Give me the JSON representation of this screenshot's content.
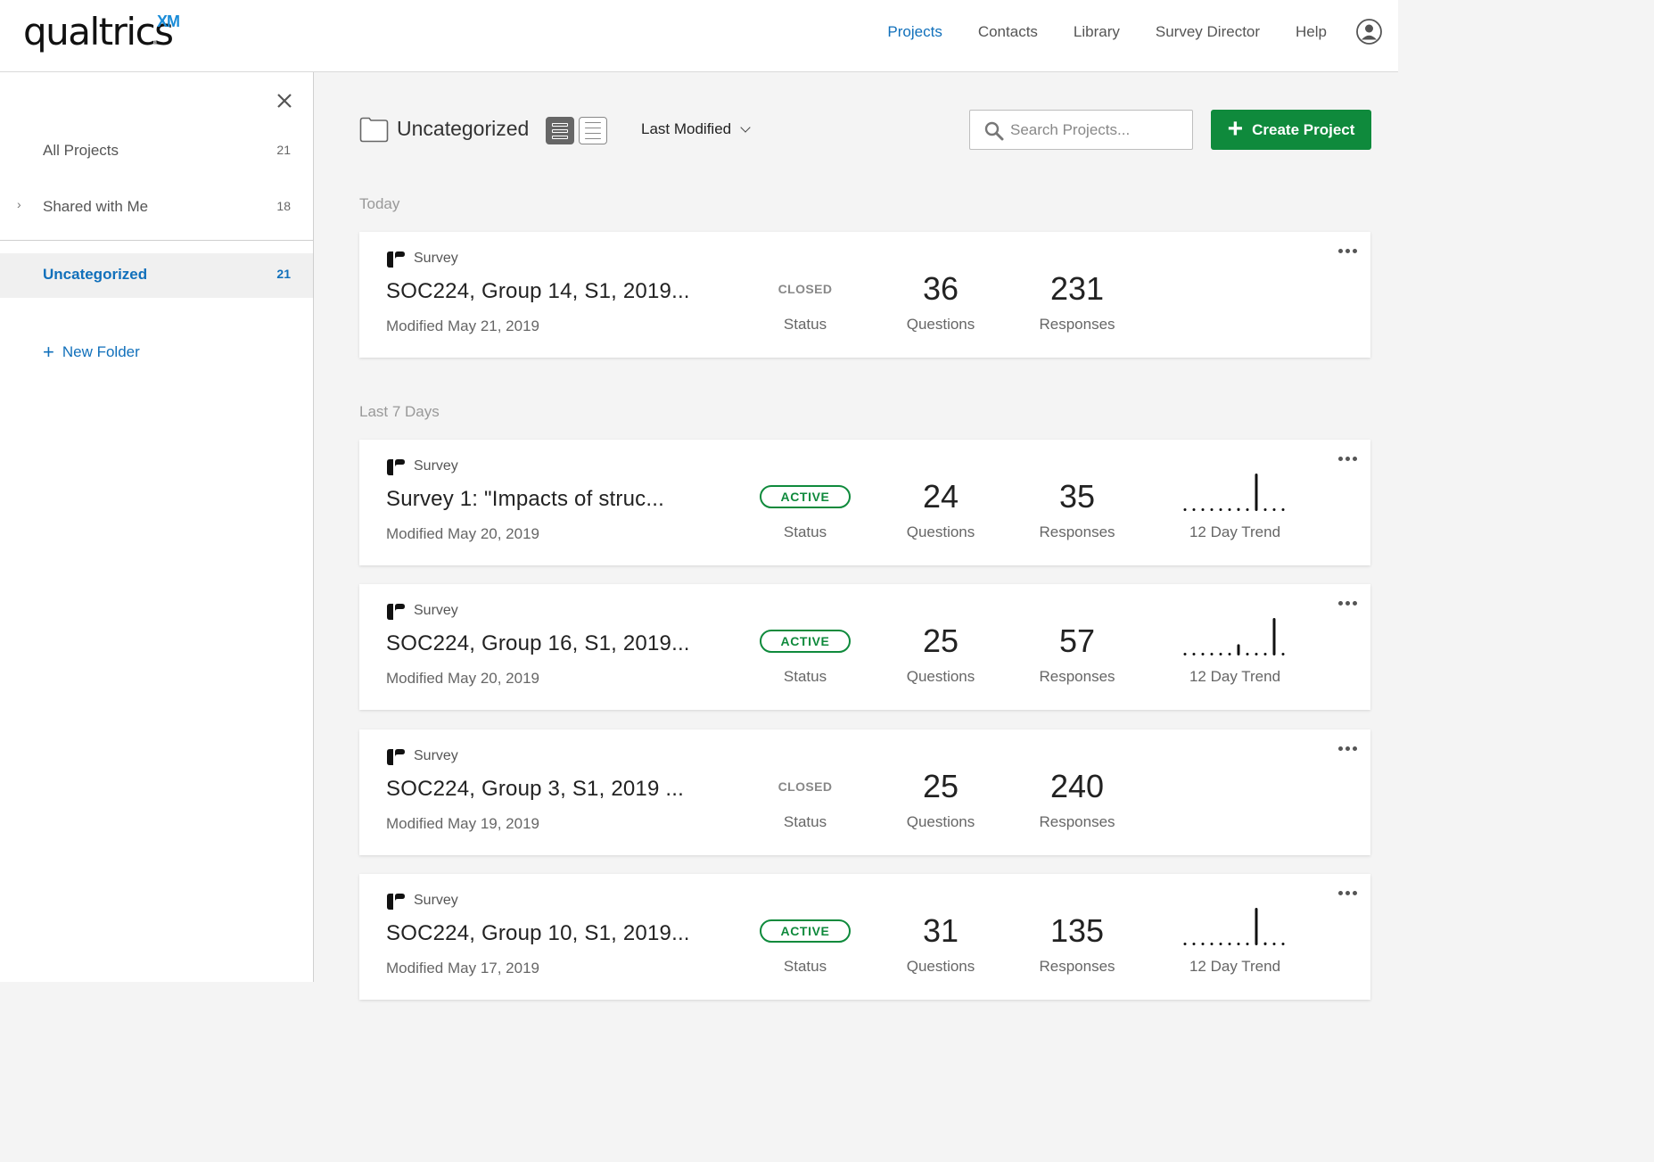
{
  "header": {
    "logo_text": "qualtrics",
    "logo_suffix": "XM",
    "nav": [
      "Projects",
      "Contacts",
      "Library",
      "Survey Director",
      "Help"
    ],
    "active_nav": "Projects"
  },
  "sidebar": {
    "items": [
      {
        "label": "All Projects",
        "count": "21"
      },
      {
        "label": "Shared with Me",
        "count": "18"
      },
      {
        "label": "Uncategorized",
        "count": "21"
      }
    ],
    "new_folder": "New Folder"
  },
  "toolbar": {
    "folder": "Uncategorized",
    "sort_label": "Last Modified",
    "search_placeholder": "Search Projects...",
    "create_label": "Create Project"
  },
  "groups": [
    "Today",
    "Last 7 Days"
  ],
  "labels": {
    "status": "Status",
    "questions": "Questions",
    "responses": "Responses",
    "trend": "12 Day Trend"
  },
  "projects": [
    {
      "type": "Survey",
      "name": "SOC224, Group 14, S1, 2019...",
      "modified": "Modified May 21, 2019",
      "status": "CLOSED",
      "questions": "36",
      "responses": "231",
      "trend": null
    },
    {
      "type": "Survey",
      "name": "Survey 1: \"Impacts of struc...",
      "modified": "Modified May 20, 2019",
      "status": "ACTIVE",
      "questions": "24",
      "responses": "35",
      "trend": [
        0,
        0,
        0,
        0,
        0,
        0,
        0.08,
        0,
        1,
        0,
        0,
        0
      ]
    },
    {
      "type": "Survey",
      "name": "SOC224, Group 16, S1, 2019...",
      "modified": "Modified May 20, 2019",
      "status": "ACTIVE",
      "questions": "25",
      "responses": "57",
      "trend": [
        0,
        0,
        0,
        0,
        0,
        0,
        0.3,
        0,
        0,
        0,
        1,
        0
      ]
    },
    {
      "type": "Survey",
      "name": "SOC224, Group 3, S1, 2019 ...",
      "modified": "Modified May 19, 2019",
      "status": "CLOSED",
      "questions": "25",
      "responses": "240",
      "trend": null
    },
    {
      "type": "Survey",
      "name": "SOC224, Group 10, S1, 2019...",
      "modified": "Modified May 17, 2019",
      "status": "ACTIVE",
      "questions": "31",
      "responses": "135",
      "trend": [
        0,
        0,
        0,
        0,
        0,
        0,
        0,
        0,
        1,
        0.08,
        0,
        0
      ]
    }
  ]
}
